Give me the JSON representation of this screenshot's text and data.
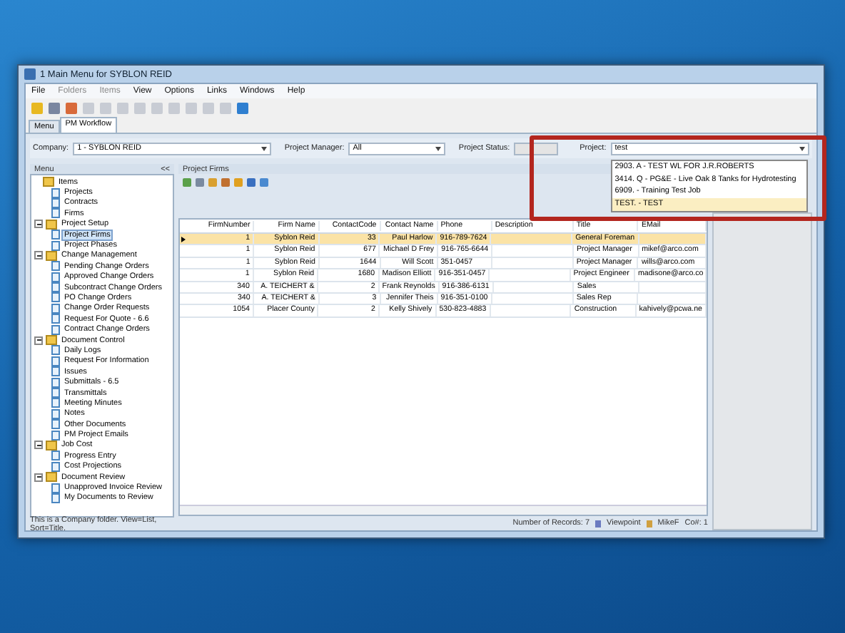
{
  "window": {
    "title": "1 Main Menu for SYBLON REID"
  },
  "menu": [
    "File",
    "Folders",
    "Items",
    "View",
    "Options",
    "Links",
    "Windows",
    "Help"
  ],
  "tabs": [
    {
      "label": "Menu",
      "selected": false
    },
    {
      "label": "PM Workflow",
      "selected": true
    }
  ],
  "filters": {
    "company": {
      "label": "Company:",
      "value": "1 - SYBLON REID"
    },
    "project_manager": {
      "label": "Project Manager:",
      "value": "All"
    },
    "project_status": {
      "label": "Project Status:"
    },
    "project": {
      "label": "Project:",
      "value": "test",
      "options": [
        {
          "label": "2903.  A -  TEST WL FOR J.R.ROBERTS",
          "selected": false
        },
        {
          "label": "3414.  Q -  PG&E - Live Oak 8 Tanks for Hydrotesting",
          "selected": false
        },
        {
          "label": "6909. -  Training Test Job",
          "selected": false
        },
        {
          "label": "TEST. -  TEST",
          "selected": true
        }
      ]
    }
  },
  "sidebar": {
    "title": "Menu",
    "collapse": "<<",
    "items": [
      {
        "label": "Items",
        "kind": "root",
        "children": [
          {
            "label": "Projects",
            "kind": "doc",
            "selected": false
          },
          {
            "label": "Contracts",
            "kind": "doc",
            "selected": false
          },
          {
            "label": "Firms",
            "kind": "doc",
            "selected": false
          }
        ]
      },
      {
        "label": "Project Setup",
        "kind": "folder",
        "expanded": true,
        "children": [
          {
            "label": "Project Firms",
            "kind": "doc",
            "selected": true
          },
          {
            "label": "Project Phases",
            "kind": "doc",
            "selected": false
          }
        ]
      },
      {
        "label": "Change Management",
        "kind": "folder",
        "expanded": true,
        "children": [
          {
            "label": "Pending Change Orders",
            "kind": "doc",
            "selected": false
          },
          {
            "label": "Approved Change Orders",
            "kind": "doc",
            "selected": false
          },
          {
            "label": "Subcontract Change Orders",
            "kind": "doc",
            "selected": false
          },
          {
            "label": "PO Change Orders",
            "kind": "doc",
            "selected": false
          },
          {
            "label": "Change Order Requests",
            "kind": "doc",
            "selected": false
          },
          {
            "label": "Request For Quote - 6.6",
            "kind": "doc",
            "selected": false
          },
          {
            "label": "Contract Change Orders",
            "kind": "doc",
            "selected": false
          }
        ]
      },
      {
        "label": "Document Control",
        "kind": "folder",
        "expanded": true,
        "children": [
          {
            "label": "Daily Logs",
            "kind": "doc",
            "selected": false
          },
          {
            "label": "Request For Information",
            "kind": "doc",
            "selected": false
          },
          {
            "label": "Issues",
            "kind": "doc",
            "selected": false
          },
          {
            "label": "Submittals - 6.5",
            "kind": "doc",
            "selected": false
          },
          {
            "label": "Transmittals",
            "kind": "doc",
            "selected": false
          },
          {
            "label": "Meeting Minutes",
            "kind": "doc",
            "selected": false
          },
          {
            "label": "Notes",
            "kind": "doc",
            "selected": false
          },
          {
            "label": "Other Documents",
            "kind": "doc",
            "selected": false
          },
          {
            "label": "PM Project Emails",
            "kind": "doc",
            "selected": false
          }
        ]
      },
      {
        "label": "Job Cost",
        "kind": "folder",
        "expanded": true,
        "children": [
          {
            "label": "Progress Entry",
            "kind": "doc",
            "selected": false
          },
          {
            "label": "Cost Projections",
            "kind": "doc",
            "selected": false
          }
        ]
      },
      {
        "label": "Document Review",
        "kind": "folder",
        "expanded": true,
        "children": [
          {
            "label": "Unapproved Invoice Review",
            "kind": "doc",
            "selected": false
          },
          {
            "label": "My Documents to Review",
            "kind": "doc",
            "selected": false
          }
        ]
      }
    ]
  },
  "table": {
    "title": "Project Firms",
    "columns": [
      "FirmNumber",
      "Firm Name",
      "ContactCode",
      "Contact Name",
      "Phone",
      "Description",
      "Title",
      "EMail"
    ],
    "rows": [
      {
        "selected": true,
        "cells": [
          "1",
          "Syblon Reid",
          "33",
          "Paul  Harlow",
          "916-789-7624",
          "",
          "General Foreman",
          ""
        ]
      },
      {
        "selected": false,
        "cells": [
          "1",
          "Syblon Reid",
          "677",
          "Michael D Frey",
          "916-765-6644",
          "",
          "Project Manager",
          "mikef@arco.com"
        ]
      },
      {
        "selected": false,
        "cells": [
          "1",
          "Syblon Reid",
          "1644",
          "Will  Scott",
          "351-0457",
          "",
          "Project Manager",
          "wills@arco.com"
        ]
      },
      {
        "selected": false,
        "cells": [
          "1",
          "Syblon Reid",
          "1680",
          "Madison  Elliott",
          "916-351-0457",
          "",
          "Project Engineer",
          "madisone@arco.co"
        ]
      },
      {
        "selected": false,
        "cells": [
          "340",
          "A. TEICHERT &",
          "2",
          "Frank  Reynolds",
          "916-386-6131",
          "",
          "Sales",
          ""
        ]
      },
      {
        "selected": false,
        "cells": [
          "340",
          "A. TEICHERT &",
          "3",
          "Jennifer  Theis",
          "916-351-0100",
          "",
          "Sales Rep",
          ""
        ]
      },
      {
        "selected": false,
        "cells": [
          "1054",
          "Placer County",
          "2",
          "Kelly  Shively",
          "530-823-4883",
          "",
          "Construction",
          "kahively@pcwa.ne"
        ]
      }
    ]
  },
  "status_bar": {
    "left": "This is a Company folder.  View=List, Sort=Title.",
    "records": "Number of Records: 7",
    "viewpoint": "Viewpoint",
    "user": "MikeF",
    "company": "Co#: 1"
  }
}
